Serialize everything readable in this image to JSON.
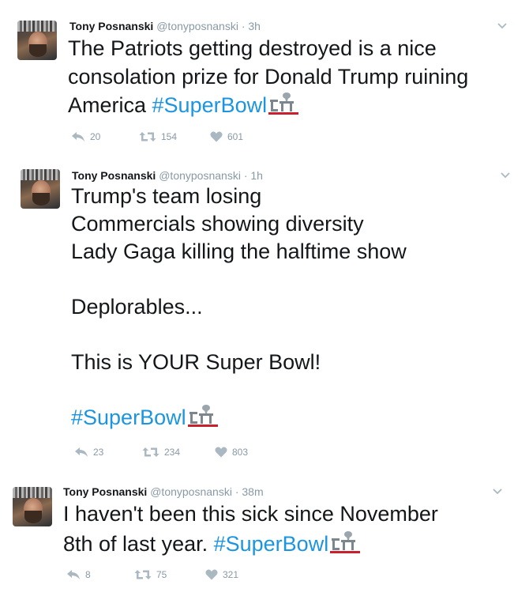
{
  "tweets": [
    {
      "name": "Tony Posnanski",
      "handle": "@tonyposnanski",
      "time": "3h",
      "lines": [
        "The Patriots getting destroyed is a nice",
        "consolation prize for Donald Trump ruining",
        "America "
      ],
      "hashtag": "#SuperBowl",
      "reply": "20",
      "retweet": "154",
      "like": "601"
    },
    {
      "name": "Tony Posnanski",
      "handle": "@tonyposnanski",
      "time": "1h",
      "lines": [
        "Trump's team losing",
        "Commercials showing diversity",
        "Lady Gaga killing the halftime show",
        "",
        "Deplorables...",
        "",
        "This is YOUR Super Bowl!",
        "",
        ""
      ],
      "hashtag": "#SuperBowl",
      "reply": "23",
      "retweet": "234",
      "like": "803"
    },
    {
      "name": "Tony Posnanski",
      "handle": "@tonyposnanski",
      "time": "38m",
      "lines": [
        "I haven't been this sick since November",
        "8th of last year. "
      ],
      "hashtag": "#SuperBowl",
      "reply": "8",
      "retweet": "75",
      "like": "321"
    }
  ],
  "separator": "·",
  "icons": {
    "menu": "chevron-down-icon",
    "reply": "reply-icon",
    "retweet": "retweet-icon",
    "like": "heart-icon",
    "emoji": "super-bowl-li-logo-icon"
  }
}
